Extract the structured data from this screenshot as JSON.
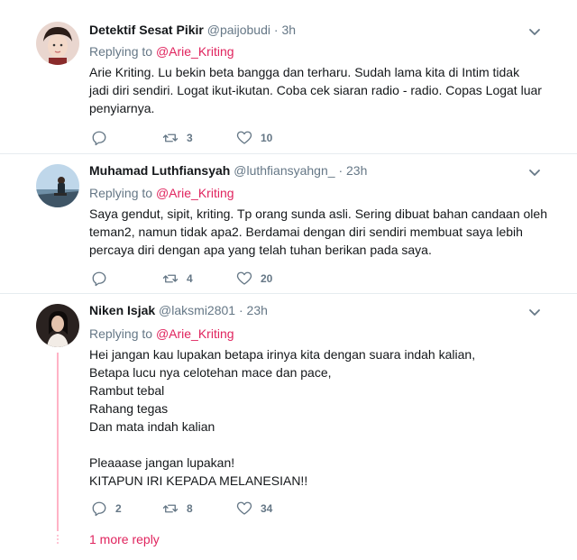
{
  "tweets": [
    {
      "name": "Detektif Sesat Pikir",
      "handle": "@paijobudi",
      "dot": "·",
      "time": "3h",
      "reply_prefix": "Replying to ",
      "reply_to": "@Arie_Kriting",
      "text": "Arie Kriting. Lu bekin beta bangga dan terharu. Sudah lama kita di Intim tidak\njadi diri sendiri. Logat ikut-ikutan. Coba cek siaran radio - radio. Copas Logat luar\npenyiarnya.",
      "replies": "",
      "retweets": "3",
      "likes": "10"
    },
    {
      "name": "Muhamad Luthfiansyah",
      "handle": "@luthfiansyahgn_",
      "dot": "·",
      "time": "23h",
      "reply_prefix": "Replying to ",
      "reply_to": "@Arie_Kriting",
      "text": "Saya gendut, sipit, kriting. Tp orang sunda asli. Sering dibuat bahan candaan oleh\nteman2, namun tidak apa2. Berdamai dengan diri sendiri membuat saya lebih\npercaya diri dengan apa yang telah tuhan berikan pada saya.",
      "replies": "",
      "retweets": "4",
      "likes": "20"
    },
    {
      "name": "Niken Isjak",
      "handle": "@laksmi2801",
      "dot": "·",
      "time": "23h",
      "reply_prefix": "Replying to ",
      "reply_to": "@Arie_Kriting",
      "text": "Hei jangan kau lupakan betapa irinya kita dengan suara indah kalian,\nBetapa lucu nya celotehan mace dan pace,\nRambut tebal\nRahang tegas\nDan mata indah kalian\n\nPleaaase jangan lupakan!\n KITAPUN IRI KEPADA MELANESIAN!!",
      "replies": "2",
      "retweets": "8",
      "likes": "34"
    }
  ],
  "more_replies": "1 more reply",
  "icons": {
    "reply": "reply-icon",
    "retweet": "retweet-icon",
    "like": "heart-icon",
    "menu": "chevron-down-icon"
  },
  "colors": {
    "accent": "#e0245e",
    "muted": "#657786",
    "thread": "#ffb3c6"
  }
}
